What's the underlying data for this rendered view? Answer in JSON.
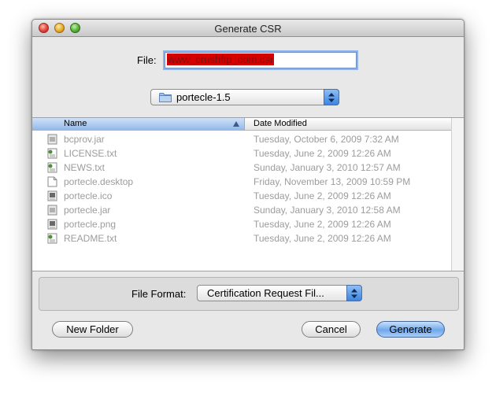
{
  "window": {
    "title": "Generate CSR"
  },
  "file": {
    "label": "File:",
    "value": "www_crushftp_com.csr"
  },
  "location": {
    "folder": "portecle-1.5"
  },
  "browser": {
    "columns": {
      "name": "Name",
      "date": "Date Modified"
    },
    "files": [
      {
        "name": "bcprov.jar",
        "date": "Tuesday, October 6, 2009 7:32 AM",
        "icon": "jar-file-icon"
      },
      {
        "name": "LICENSE.txt",
        "date": "Tuesday, June 2, 2009 12:26 AM",
        "icon": "text-file-icon"
      },
      {
        "name": "NEWS.txt",
        "date": "Sunday, January 3, 2010 12:57 AM",
        "icon": "text-file-icon"
      },
      {
        "name": "portecle.desktop",
        "date": "Friday, November 13, 2009 10:59 PM",
        "icon": "document-icon"
      },
      {
        "name": "portecle.ico",
        "date": "Tuesday, June 2, 2009 12:26 AM",
        "icon": "image-file-icon"
      },
      {
        "name": "portecle.jar",
        "date": "Sunday, January 3, 2010 12:58 AM",
        "icon": "jar-file-icon"
      },
      {
        "name": "portecle.png",
        "date": "Tuesday, June 2, 2009 12:26 AM",
        "icon": "image-file-icon"
      },
      {
        "name": "README.txt",
        "date": "Tuesday, June 2, 2009 12:26 AM",
        "icon": "text-file-icon"
      }
    ]
  },
  "format": {
    "label": "File Format:",
    "selected": "Certification Request Fil..."
  },
  "buttons": {
    "new_folder": "New Folder",
    "cancel": "Cancel",
    "generate": "Generate"
  },
  "colors": {
    "selection": "#d40000",
    "accent": "#6fa8ec",
    "disabled_text": "#9c9c9c"
  }
}
